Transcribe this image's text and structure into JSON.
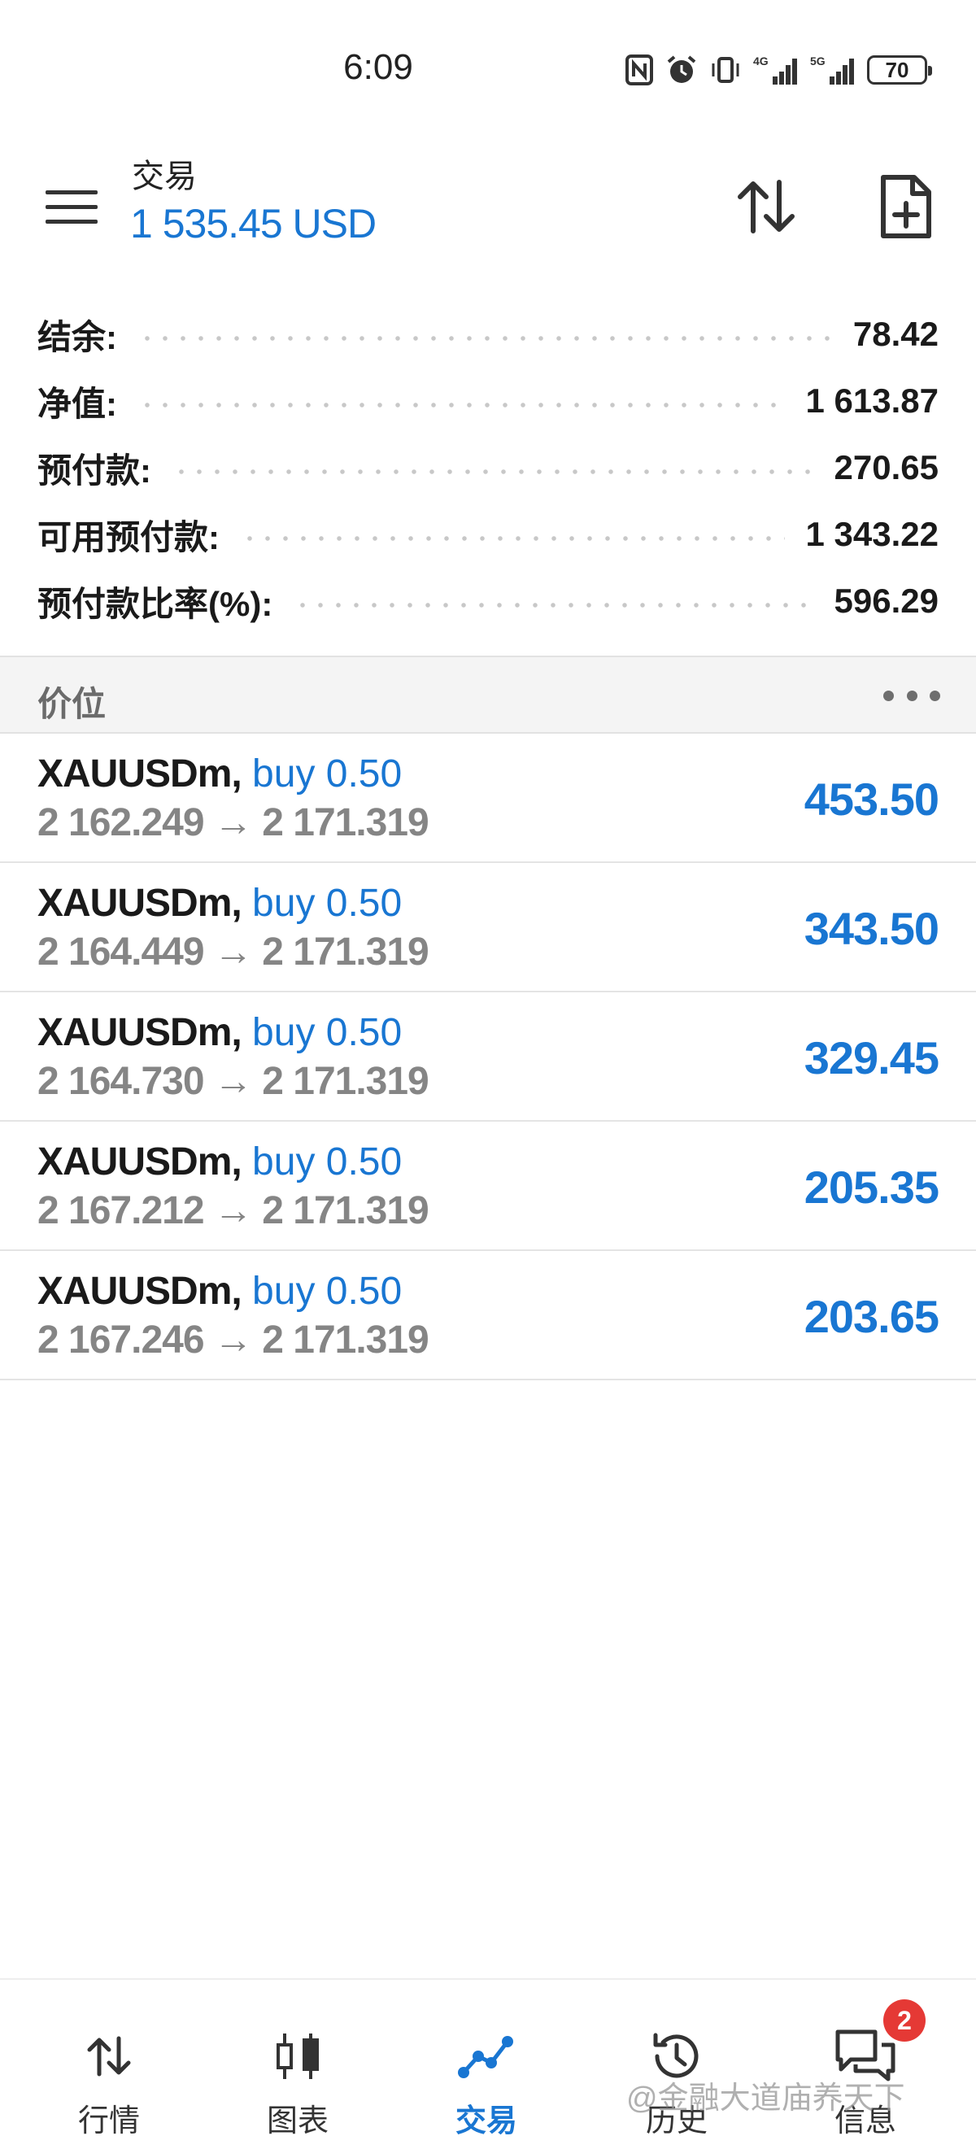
{
  "status_bar": {
    "time": "6:09",
    "battery": "70",
    "network_1": "4G",
    "network_2": "5G"
  },
  "header": {
    "title": "交易",
    "balance": "1 535.45 USD"
  },
  "summary": [
    {
      "label": "结余:",
      "value": "78.42"
    },
    {
      "label": "净值:",
      "value": "1 613.87"
    },
    {
      "label": "预付款:",
      "value": "270.65"
    },
    {
      "label": "可用预付款:",
      "value": "1 343.22"
    },
    {
      "label": "预付款比率(%):",
      "value": "596.29"
    }
  ],
  "section": {
    "title": "价位"
  },
  "positions": [
    {
      "symbol": "XAUUSDm,",
      "direction": "buy 0.50",
      "prices": "2 162.249 → 2 171.319",
      "profit": "453.50"
    },
    {
      "symbol": "XAUUSDm,",
      "direction": "buy 0.50",
      "prices": "2 164.449 → 2 171.319",
      "profit": "343.50"
    },
    {
      "symbol": "XAUUSDm,",
      "direction": "buy 0.50",
      "prices": "2 164.730 → 2 171.319",
      "profit": "329.45"
    },
    {
      "symbol": "XAUUSDm,",
      "direction": "buy 0.50",
      "prices": "2 167.212 → 2 171.319",
      "profit": "205.35"
    },
    {
      "symbol": "XAUUSDm,",
      "direction": "buy 0.50",
      "prices": "2 167.246 → 2 171.319",
      "profit": "203.65"
    }
  ],
  "nav": [
    {
      "label": "行情",
      "icon": "quotes-icon"
    },
    {
      "label": "图表",
      "icon": "chart-icon"
    },
    {
      "label": "交易",
      "icon": "trade-icon",
      "active": true
    },
    {
      "label": "历史",
      "icon": "history-icon"
    },
    {
      "label": "信息",
      "icon": "messages-icon"
    }
  ],
  "badge": "2",
  "watermark": "@金融大道庙养天下",
  "colors": {
    "accent": "#1976d2",
    "badge": "#e53935",
    "muted": "#858585"
  }
}
